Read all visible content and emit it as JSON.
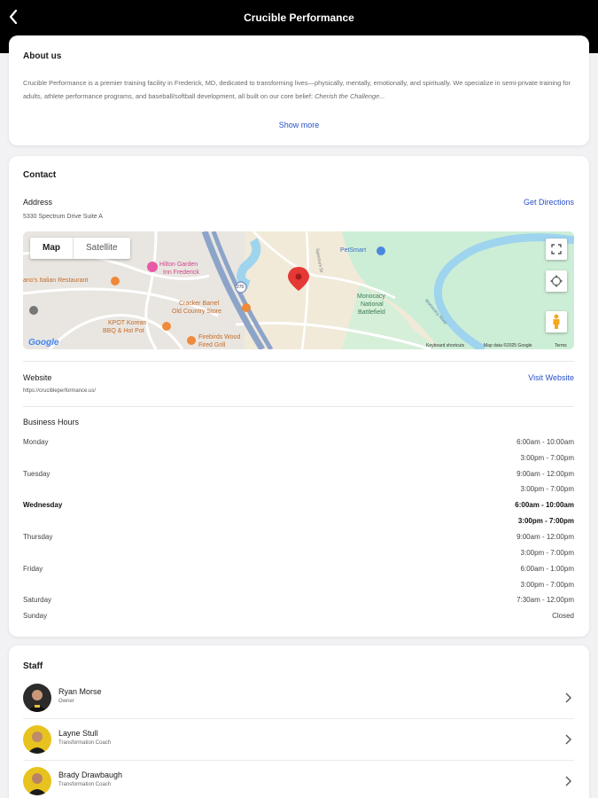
{
  "header": {
    "title": "Crucible Performance"
  },
  "about": {
    "heading": "About us",
    "text_line1": "Crucible Performance is a premier training facility in Frederick, MD, dedicated to transforming lives—physically, mentally, emotionally, and spiritually.",
    "text_line2": "We specialize in semi-private training for adults, athlete performance programs, and baseball/softball development, all built on our core belief:",
    "text_italic_a": "Cherish",
    "text_italic_b": "the Challenge...",
    "show_more": "Show more"
  },
  "contact": {
    "heading": "Contact",
    "address_label": "Address",
    "address_value": "5330 Spectrum Drive Suite A",
    "directions_link": "Get Directions",
    "website_label": "Website",
    "website_value": "https://crucibleperformance.us/",
    "website_link": "Visit Website",
    "map": {
      "tab_map": "Map",
      "tab_satellite": "Satellite",
      "places": [
        "Hilton Garden",
        "Inn Frederick",
        "ano's Italian Restaurant",
        "Cracker Barrel",
        "Old Country Store",
        "KPOT Korean",
        "BBQ & Hot Pot",
        "Firebirds Wood",
        "Fired Grill",
        "PetSmart",
        "Monocacy",
        "National",
        "Battlefield",
        "Spectrum Dr",
        "Monocacy River"
      ],
      "highway": "270",
      "google": "Google",
      "footer_shortcuts": "Keyboard shortcuts",
      "footer_data": "Map data ©2025 Google",
      "footer_terms": "Terms"
    }
  },
  "hours": {
    "heading": "Business Hours",
    "rows": [
      {
        "day": "Monday",
        "time": "6:00am - 10:00am"
      },
      {
        "day": "",
        "time": "3:00pm - 7:00pm"
      },
      {
        "day": "Tuesday",
        "time": "9:00am - 12:00pm"
      },
      {
        "day": "",
        "time": "3:00pm - 7:00pm"
      },
      {
        "day": "Wednesday",
        "time": "6:00am - 10:00am"
      },
      {
        "day": "",
        "time": "3:00pm - 7:00pm"
      },
      {
        "day": "Thursday",
        "time": "9:00am - 12:00pm"
      },
      {
        "day": "",
        "time": "3:00pm - 7:00pm"
      },
      {
        "day": "Friday",
        "time": "6:00am - 1:00pm"
      },
      {
        "day": "",
        "time": "3:00pm - 7:00pm"
      },
      {
        "day": "Saturday",
        "time": "7:30am - 12:00pm"
      },
      {
        "day": "Sunday",
        "time": "Closed"
      }
    ]
  },
  "staff": {
    "heading": "Staff",
    "members": [
      {
        "name": "Ryan Morse",
        "role": "Owner"
      },
      {
        "name": "Layne Stull",
        "role": "Transformation Coach"
      },
      {
        "name": "Brady Drawbaugh",
        "role": "Transformation Coach"
      }
    ]
  },
  "colors": {
    "header_bg": "#000000",
    "link": "#2750c8",
    "map_pin": "#e53935",
    "map_water": "#9fd4ee",
    "map_park": "#c8ecd3"
  }
}
